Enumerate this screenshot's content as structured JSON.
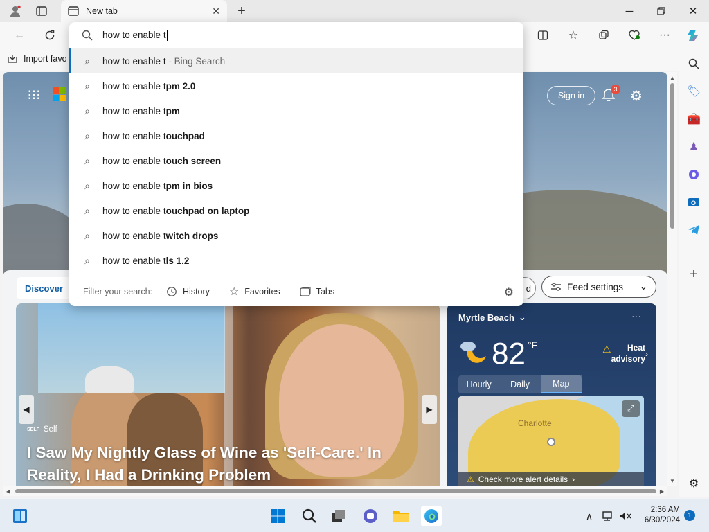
{
  "browser": {
    "tab_title": "New tab",
    "favorites_import": "Import favo",
    "address_text": "how to enable t"
  },
  "omnibox": {
    "suggestions": [
      {
        "prefix": "how to enable t",
        "bold": "",
        "engine": " - Bing Search"
      },
      {
        "prefix": "how to enable t",
        "bold": "pm 2.0",
        "engine": ""
      },
      {
        "prefix": "how to enable t",
        "bold": "pm",
        "engine": ""
      },
      {
        "prefix": "how to enable t",
        "bold": "ouchpad",
        "engine": ""
      },
      {
        "prefix": "how to enable t",
        "bold": "ouch screen",
        "engine": ""
      },
      {
        "prefix": "how to enable t",
        "bold": "pm in bios",
        "engine": ""
      },
      {
        "prefix": "how to enable t",
        "bold": "ouchpad on laptop",
        "engine": ""
      },
      {
        "prefix": "how to enable t",
        "bold": "witch drops",
        "engine": ""
      },
      {
        "prefix": "how to enable t",
        "bold": "ls 1.2",
        "engine": ""
      }
    ],
    "filter_label": "Filter your search:",
    "filters": [
      "History",
      "Favorites",
      "Tabs"
    ]
  },
  "newtab": {
    "sign_in": "Sign in",
    "notification_count": "3",
    "discover": "Discover",
    "pill_partial": "d",
    "feed_settings": "Feed settings",
    "hero": {
      "source": "Self",
      "headline": "I Saw My Nightly Glass of Wine as 'Self-Care.' In Reality, I Had a Drinking Problem"
    },
    "weather": {
      "location": "Myrtle Beach",
      "temperature": "82",
      "unit": "°F",
      "alert_line1": "Heat",
      "alert_line2": "advisory",
      "tabs": [
        "Hourly",
        "Daily",
        "Map"
      ],
      "active_tab": "Map",
      "map_city": "Charlotte",
      "alert_link": "Check more alert details"
    }
  },
  "taskbar": {
    "time": "2:36 AM",
    "date": "6/30/2024",
    "notification_count": "1"
  },
  "colors": {
    "accent": "#0f6cbd",
    "badge_red": "#e74c3c",
    "weather_bg": "#1f3a63"
  }
}
